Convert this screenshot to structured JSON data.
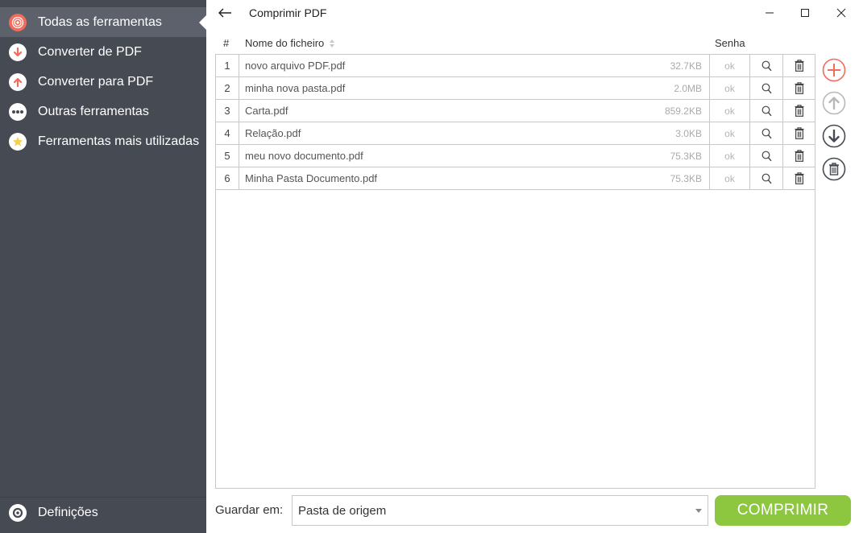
{
  "window": {
    "title": "Comprimir PDF"
  },
  "sidebar": {
    "items": [
      {
        "label": "Todas as ferramentas",
        "icon": "target-icon",
        "active": true,
        "color": "#f26b5b"
      },
      {
        "label": "Converter de PDF",
        "icon": "arrow-down-icon",
        "active": false,
        "color": "#f26b5b"
      },
      {
        "label": "Converter para PDF",
        "icon": "arrow-up-icon",
        "active": false,
        "color": "#f26b5b"
      },
      {
        "label": "Outras ferramentas",
        "icon": "more-dots-icon",
        "active": false,
        "color": "#ffffff"
      },
      {
        "label": "Ferramentas mais utilizadas",
        "icon": "star-icon",
        "active": false,
        "color": "#f5d04e"
      }
    ],
    "settings_label": "Definições"
  },
  "table": {
    "headers": {
      "number": "#",
      "name": "Nome do ficheiro",
      "password": "Senha"
    },
    "rows": [
      {
        "num": "1",
        "name": "novo arquivo PDF.pdf",
        "size": "32.7KB",
        "password": "ok"
      },
      {
        "num": "2",
        "name": "minha nova pasta.pdf",
        "size": "2.0MB",
        "password": "ok"
      },
      {
        "num": "3",
        "name": "Carta.pdf",
        "size": "859.2KB",
        "password": "ok"
      },
      {
        "num": "4",
        "name": "Relação.pdf",
        "size": "3.0KB",
        "password": "ok"
      },
      {
        "num": "5",
        "name": "meu novo documento.pdf",
        "size": "75.3KB",
        "password": "ok"
      },
      {
        "num": "6",
        "name": "Minha Pasta Documento.pdf",
        "size": "75.3KB",
        "password": "ok"
      }
    ]
  },
  "actions": {
    "add": "add-circle-icon",
    "move_up": "move-up-icon",
    "move_down": "move-down-icon",
    "clear": "trash-circle-icon"
  },
  "footer": {
    "save_in_label": "Guardar em:",
    "save_in_value": "Pasta de origem",
    "compress_label": "COMPRIMIR"
  },
  "colors": {
    "sidebar_bg": "#464a53",
    "sidebar_active": "#5c616c",
    "accent_red": "#f26b5b",
    "button_green": "#8dc63f"
  }
}
